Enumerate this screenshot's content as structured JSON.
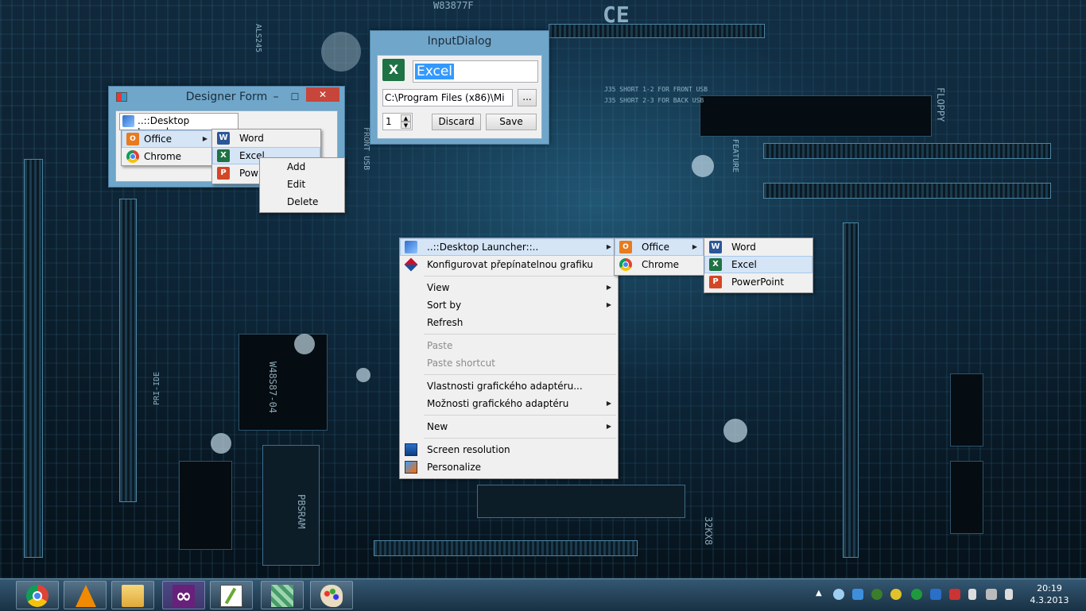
{
  "designer_form": {
    "title": "Designer Form",
    "launcher_item": "..::Desktop Launcher::..",
    "items": [
      {
        "label": "Office"
      },
      {
        "label": "Chrome"
      }
    ],
    "submenu": [
      {
        "label": "Word"
      },
      {
        "label": "Excel"
      },
      {
        "label": "Pow"
      }
    ],
    "context_menu": [
      {
        "label": "Add"
      },
      {
        "label": "Edit"
      },
      {
        "label": "Delete"
      }
    ]
  },
  "input_dialog": {
    "title": "InputDialog",
    "name_value": "Excel",
    "path_value": "C:\\Program Files (x86)\\Mi",
    "browse_label": "...",
    "order_value": "1",
    "discard_label": "Discard",
    "save_label": "Save"
  },
  "desktop_menu": {
    "items": {
      "launcher": "..::Desktop Launcher::..",
      "switchable_graphics": "Konfigurovat přepínatelnou grafiku",
      "view": "View",
      "sort_by": "Sort by",
      "refresh": "Refresh",
      "paste": "Paste",
      "paste_shortcut": "Paste shortcut",
      "adapter_properties": "Vlastnosti grafického adaptéru...",
      "adapter_options": "Možnosti grafického adaptéru",
      "new": "New",
      "screen_resolution": "Screen resolution",
      "personalize": "Personalize"
    },
    "launcher_submenu": {
      "office": "Office",
      "chrome": "Chrome"
    },
    "office_submenu": {
      "word": "Word",
      "excel": "Excel",
      "powerpoint": "PowerPoint"
    }
  },
  "wallpaper_silkscreen": {
    "part": "W83877F",
    "ce": "CE",
    "als": "ALS245",
    "j35a": "J35 SHORT 1-2 FOR FRONT USB",
    "j35b": "J35 SHORT 2-3 FOR BACK USB",
    "floppy": "FLOPPY",
    "feature": "FEATURE",
    "pri_ide": "PRI-IDE",
    "pbsram": "PBSRAM",
    "chip": "W48S87-04",
    "mem": "32KX8",
    "front_usb": "FRONT USB"
  },
  "taskbar": {
    "apps": [
      "chrome-icon",
      "vlc-icon",
      "file-explorer-icon",
      "visual-studio-icon",
      "notepad-icon",
      "desktop-launcher-icon",
      "paint-icon"
    ],
    "time": "20:19",
    "date": "4.3.2013"
  }
}
